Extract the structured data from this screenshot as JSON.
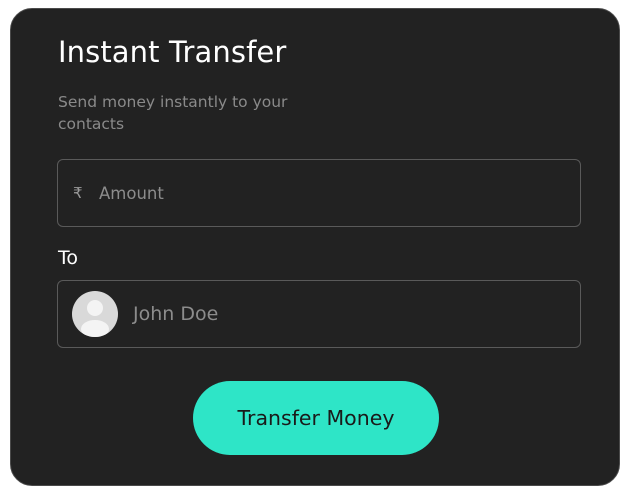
{
  "card": {
    "title": "Instant Transfer",
    "subtitle": "Send money instantly to your contacts"
  },
  "amount": {
    "currency_symbol": "₹",
    "placeholder": "Amount",
    "value": ""
  },
  "recipient": {
    "label": "To",
    "name": "John Doe",
    "avatar_icon": "user-avatar-icon"
  },
  "actions": {
    "submit_label": "Transfer Money"
  },
  "colors": {
    "card_background": "#222222",
    "accent": "#2ee5c7",
    "muted_text": "#8c8c8c"
  }
}
